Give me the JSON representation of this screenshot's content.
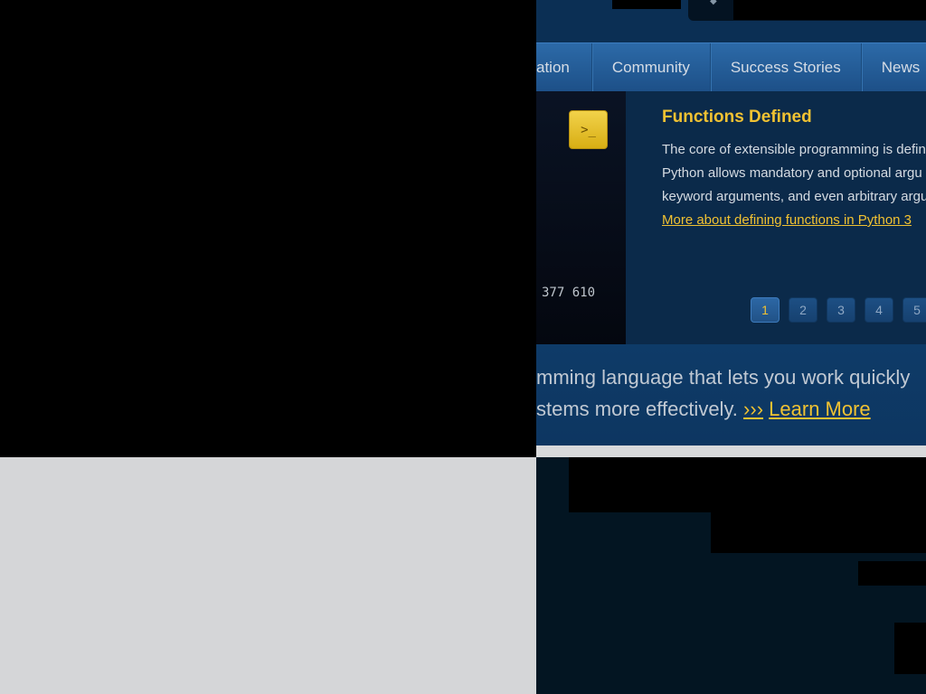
{
  "nav": {
    "items": [
      {
        "label": "ation"
      },
      {
        "label": "Community"
      },
      {
        "label": "Success Stories"
      },
      {
        "label": "News"
      }
    ]
  },
  "shell": {
    "icon": "terminal-prompt-icon",
    "glyph": ">_"
  },
  "code_output": "377 610",
  "feature": {
    "title": "Functions Defined",
    "body_lines": [
      "The core of extensible programming is defin",
      "Python allows mandatory and optional argu",
      "keyword arguments, and even arbitrary argu"
    ],
    "link": "More about defining functions in Python 3"
  },
  "pager": {
    "pages": [
      "1",
      "2",
      "3",
      "4",
      "5"
    ],
    "active": "1"
  },
  "intro": {
    "line1": "mming language that lets you work quickly",
    "line2_prefix": "stems more effectively. ",
    "arrows": "›››",
    "learn_more": "Learn More"
  },
  "colors": {
    "accent": "#f1c232",
    "nav_blue": "#2c6aa8",
    "panel_dark": "#0b2a4a"
  }
}
